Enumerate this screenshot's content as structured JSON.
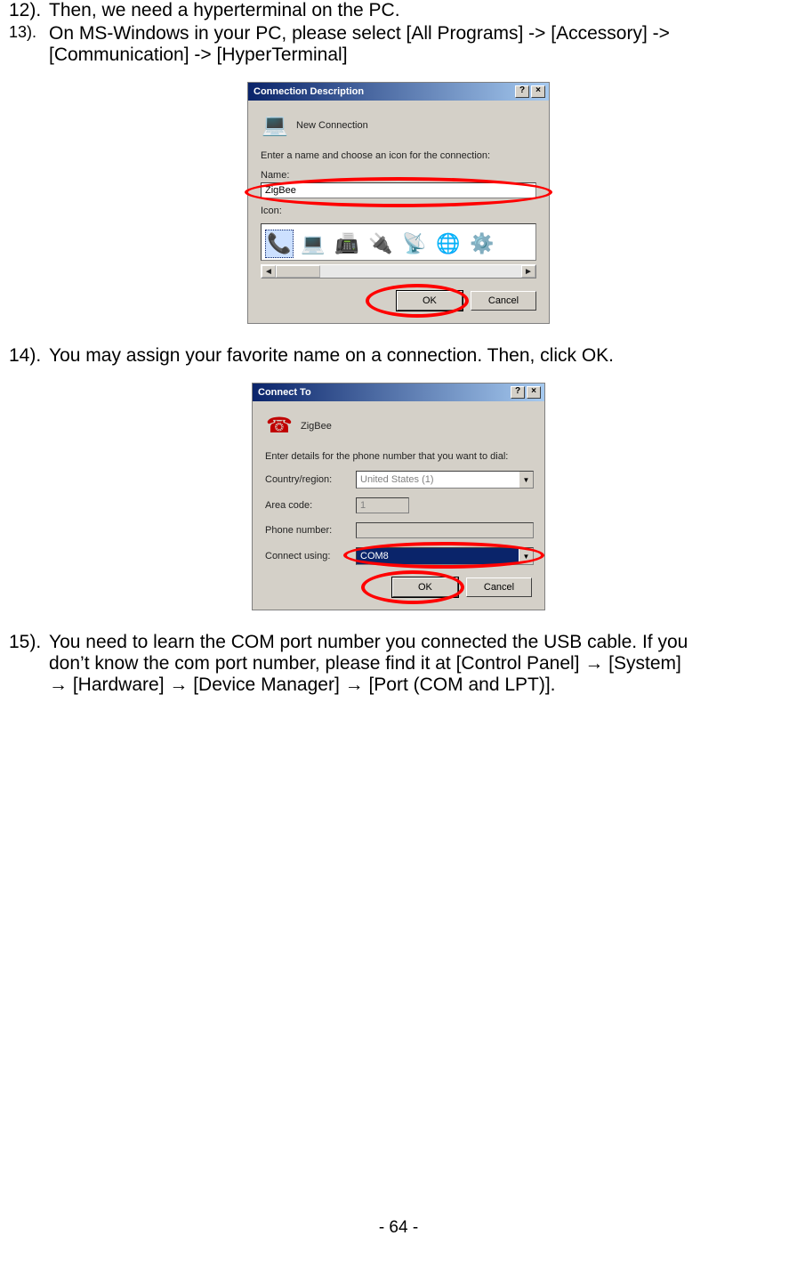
{
  "steps": {
    "s12": {
      "num": "12).",
      "text": "Then, we need a hyperterminal on the PC."
    },
    "s13": {
      "num": "13).",
      "line1": "On MS-Windows in your PC, please select [All Programs] -> [Accessory] ->",
      "line2": "[Communication] -> [HyperTerminal]"
    },
    "s14": {
      "num": "14).",
      "text": "You may assign your favorite name on a connection. Then, click OK."
    },
    "s15": {
      "num": "15).",
      "line1": "You need to learn the COM port number you connected the USB cable. If you",
      "line2": "don’t know the com port number, please find it at [Control Panel] → [System]",
      "line3": "→ [Hardware] → [Device Manager] → [Port (COM and LPT)]."
    }
  },
  "dialog1": {
    "title": "Connection Description",
    "help": "?",
    "close": "×",
    "icon_title": "New Connection",
    "prompt": "Enter a name and choose an icon for the connection:",
    "name_label": "Name:",
    "name_value": "ZigBee",
    "icon_label": "Icon:",
    "ok": "OK",
    "cancel": "Cancel"
  },
  "dialog2": {
    "title": "Connect To",
    "help": "?",
    "close": "×",
    "conn_name": "ZigBee",
    "prompt": "Enter details for the phone number that you want to dial:",
    "country_label": "Country/region:",
    "country_value": "United States (1)",
    "area_label": "Area code:",
    "area_value": "1",
    "phone_label": "Phone number:",
    "phone_value": "",
    "connect_label": "Connect using:",
    "connect_value": "COM8",
    "ok": "OK",
    "cancel": "Cancel"
  },
  "page_number": "- 64 -"
}
